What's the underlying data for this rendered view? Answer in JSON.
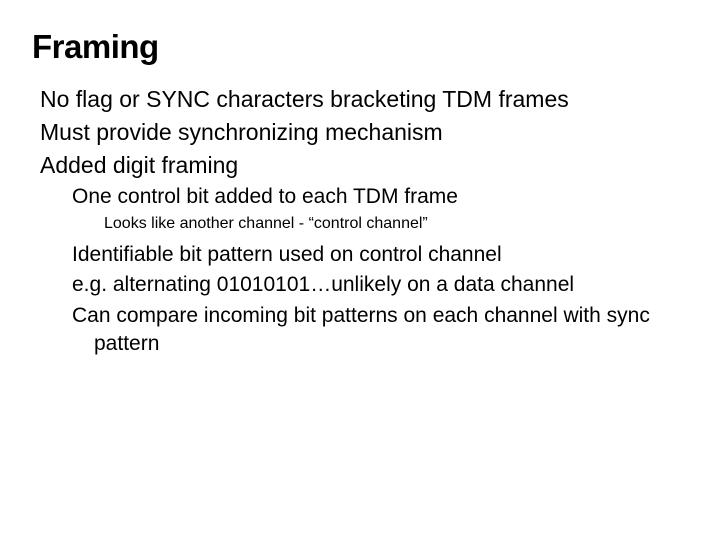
{
  "title": "Framing",
  "lines": {
    "l1a": "No flag or SYNC characters bracketing TDM frames",
    "l1b": "Must provide synchronizing mechanism",
    "l1c": "Added digit framing",
    "l2a": "One control bit added to each TDM frame",
    "l3a": "Looks like another channel - “control channel”",
    "l2b": "Identifiable bit pattern used on control channel",
    "l2c": "e.g. alternating 01010101…unlikely on a data channel",
    "l2d": "Can compare incoming bit patterns on each channel with sync pattern"
  }
}
